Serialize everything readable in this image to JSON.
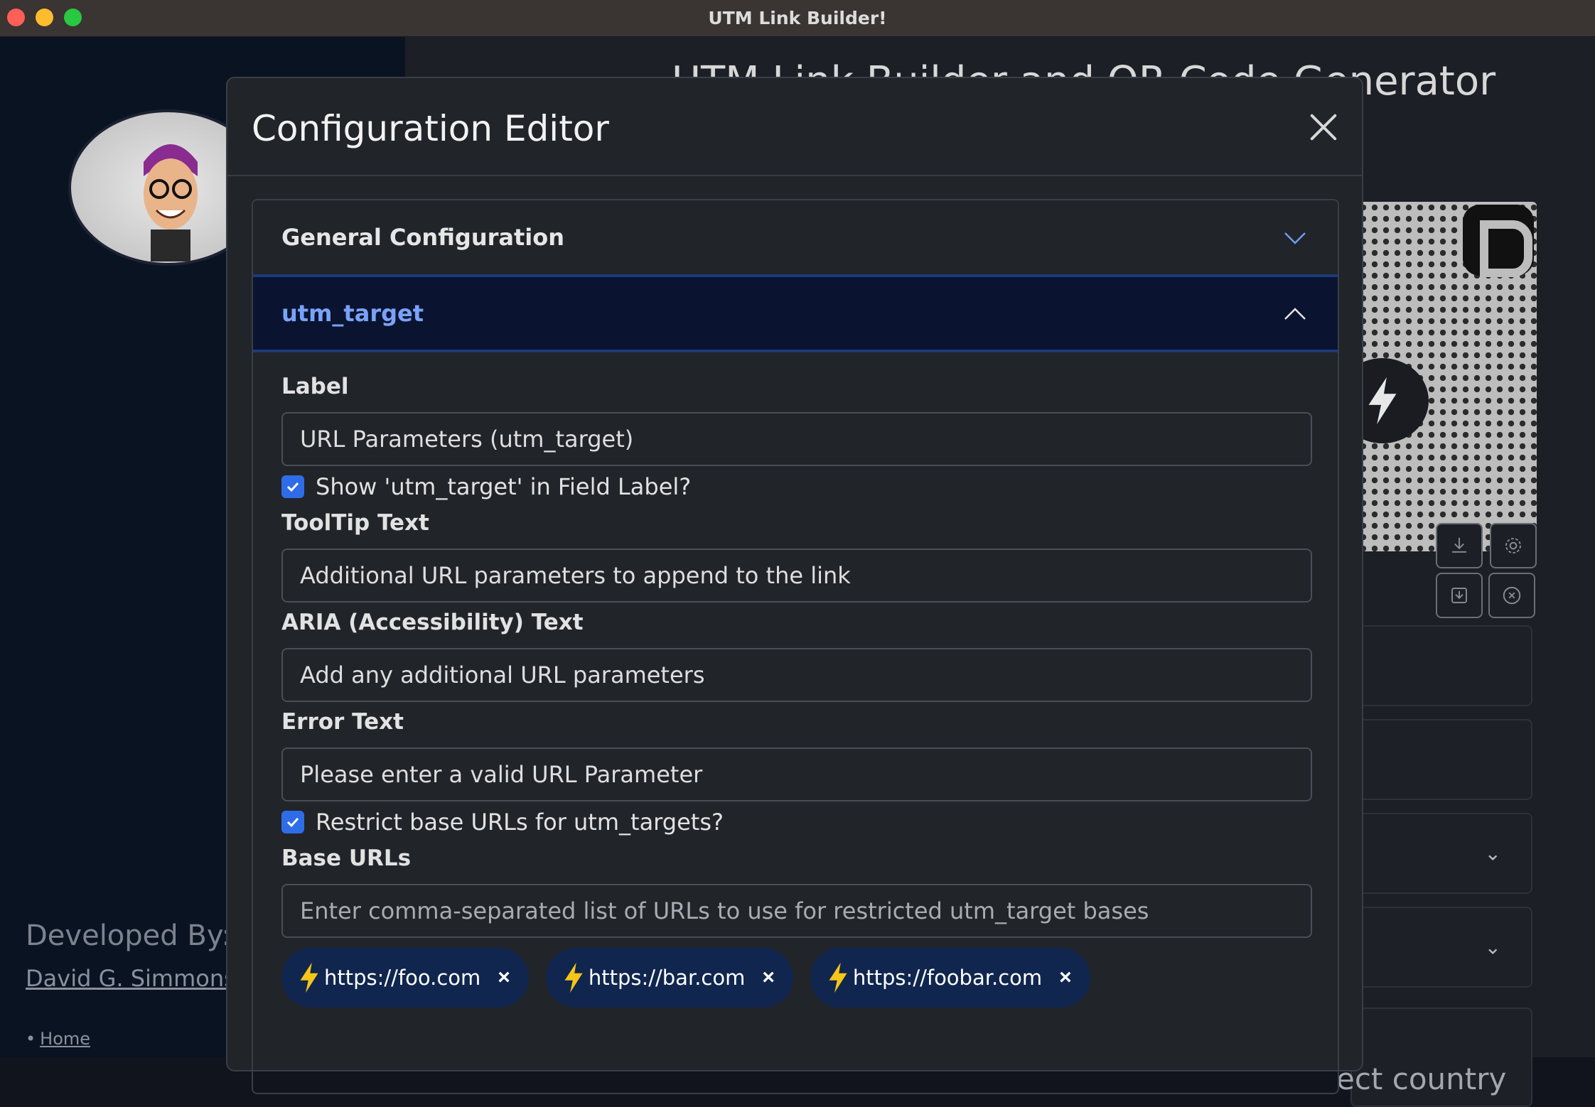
{
  "window": {
    "title": "UTM Link Builder!"
  },
  "background": {
    "heading": "UTM Link Builder and QR Code Generator",
    "developed_by": "Developed By:",
    "developer_name": "David G. Simmons",
    "nav_home": "Home",
    "country_placeholder": "ect country"
  },
  "modal": {
    "title": "Configuration Editor",
    "sections": {
      "general": {
        "label": "General Configuration",
        "expanded": false
      },
      "utm_target": {
        "label": "utm_target",
        "expanded": true
      }
    },
    "fields": {
      "label": {
        "title": "Label",
        "value": "URL Parameters (utm_target)"
      },
      "show_in_label": {
        "text": "Show 'utm_target' in Field Label?",
        "checked": true
      },
      "tooltip": {
        "title": "ToolTip Text",
        "value": "Additional URL parameters to append to the link"
      },
      "aria": {
        "title": "ARIA (Accessibility) Text",
        "value": "Add any additional URL parameters"
      },
      "error": {
        "title": "Error Text",
        "value": "Please enter a valid URL Parameter"
      },
      "restrict": {
        "text": "Restrict base URLs for utm_targets?",
        "checked": true
      },
      "base_urls": {
        "title": "Base URLs",
        "placeholder": "Enter comma-separated list of URLs to use for restricted utm_target bases",
        "chips": [
          {
            "text": "https://foo.com",
            "remove": "×"
          },
          {
            "text": "https://bar.com",
            "remove": "×"
          },
          {
            "text": "https://foobar.com",
            "remove": "×"
          }
        ]
      }
    }
  },
  "colors": {
    "accent": "#2f6de8",
    "chip_bg": "#10264e",
    "bolt": "#f5c518",
    "active_header": "#7aa2f7"
  }
}
